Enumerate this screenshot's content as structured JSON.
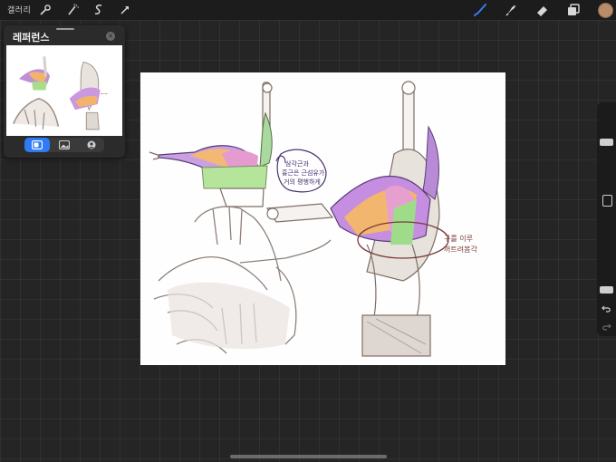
{
  "topbar": {
    "gallery_label": "갤러리",
    "left_tools": [
      "wrench-icon",
      "magic-wand-icon",
      "selection-icon",
      "transform-arrow-icon"
    ],
    "right_tools": [
      "brush-icon",
      "smudge-icon",
      "eraser-icon",
      "layers-icon",
      "color-swatch"
    ],
    "active_color": "#b98c6a",
    "brush_accent": "#3a7bf5"
  },
  "reference_panel": {
    "title": "레퍼런스",
    "modes": [
      "canvas-mode-icon",
      "image-mode-icon",
      "face-mode-icon"
    ],
    "active_mode": 0,
    "active_accent": "#2f7bf5"
  },
  "canvas": {
    "annotation_1": [
      "삼각근과",
      "흉근은 근섬유가",
      "거의 평행하게"
    ],
    "annotation_2": [
      "구를 이루",
      "꺼트려봄각"
    ]
  },
  "sidebar": {
    "size_slider_level": 0.28,
    "opacity_slider_level": 0.85
  }
}
